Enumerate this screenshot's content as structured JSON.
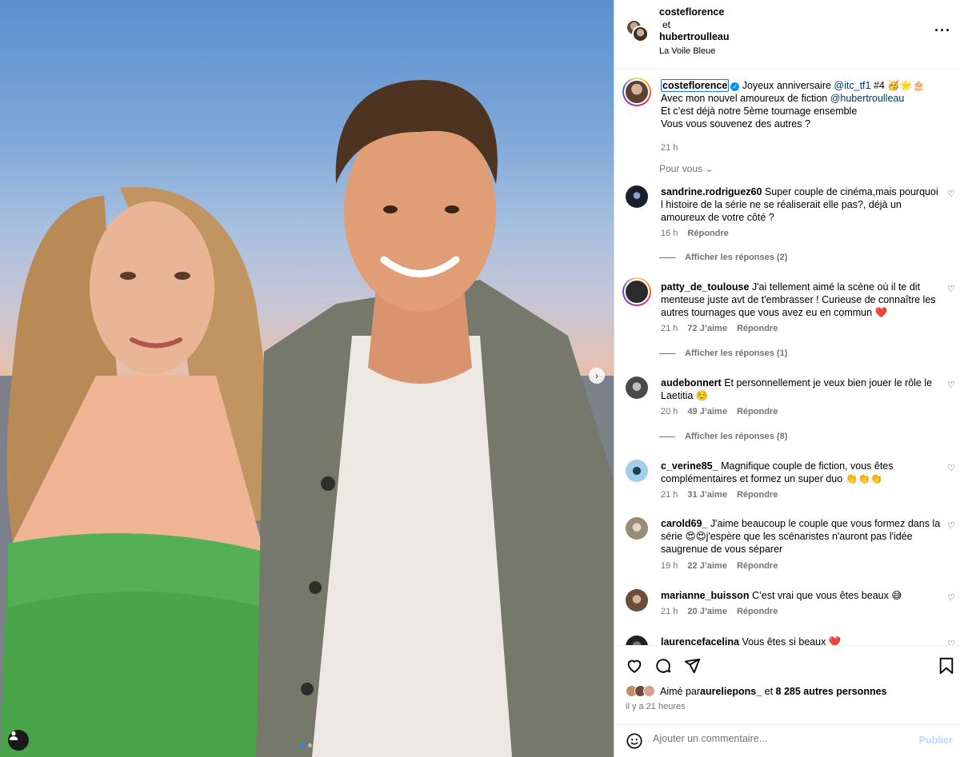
{
  "post": {
    "author": "costeflorence",
    "coauthor_sep": "et",
    "coauthor": "hubertroulleau",
    "location": "La Voile Bleue",
    "more_icon": "more-horizontal-icon"
  },
  "photo": {
    "next_icon": "chevron-right-icon",
    "tag_icon": "user-tag-icon",
    "carousel": {
      "count": 2,
      "active_index": 0
    }
  },
  "caption": {
    "username": "costeflorence",
    "verified": "✓",
    "line1_text": "Joyeux anniversaire ",
    "mention1": "@itc_tf1",
    "line1_tail": " #4 🥳🌟🎂",
    "line2_text": "Avec mon nouvel amoureux de fiction ",
    "mention2": "@hubertroulleau",
    "line3": "Et c’est déjà notre 5ème tournage ensemble",
    "line4": "Vous vous souvenez des autres ?",
    "time": "21 h"
  },
  "sort_label": "Pour vous",
  "comments": [
    {
      "username": "sandrine.rodriguez60",
      "text": "Super couple de cinéma,mais pourquoi l histoire de la série ne se réaliserait elle pas?, déjà un amoureux de votre côté ?",
      "time": "16 h",
      "likes": "",
      "reply": "Répondre",
      "replies": "Afficher les réponses (2)",
      "avatar": "#1b1e2c"
    },
    {
      "username": "patty_de_toulouse",
      "text": "J'ai tellement aimé la scène où il te dit menteuse juste avt de t'embrasser ! Curieuse de connaître les autres tournages que vous avez eu en commun ❤️",
      "time": "21 h",
      "likes": "72 J’aime",
      "reply": "Répondre",
      "replies": "Afficher les réponses (1)",
      "avatar": "#2b2b2b"
    },
    {
      "username": "audebonnert",
      "text": "Et personnellement je veux bien jouer le rôle le Laetitia ☺️",
      "time": "20 h",
      "likes": "49 J’aime",
      "reply": "Répondre",
      "replies": "Afficher les réponses (8)",
      "avatar": "#4a4a4a"
    },
    {
      "username": "c_verine85_",
      "text": "Magnifique couple de fiction, vous êtes complémentaires et formez un super duo 👏👏👏",
      "time": "21 h",
      "likes": "31 J’aime",
      "reply": "Répondre",
      "replies": "",
      "avatar": "#6aa7c8"
    },
    {
      "username": "carold69_",
      "text": "J'aime beaucoup le couple que vous formez dans la série 😍😍j'espère que les scénaristes n'auront pas l'idée saugrenue de vous séparer",
      "time": "19 h",
      "likes": "22 J’aime",
      "reply": "Répondre",
      "replies": "",
      "avatar": "#b7a898"
    },
    {
      "username": "marianne_buisson",
      "text": "C’est vrai que vous êtes beaux 😅",
      "time": "21 h",
      "likes": "20 J’aime",
      "reply": "Répondre",
      "replies": "",
      "avatar": "#8c6d5a"
    },
    {
      "username": "laurencefacelina",
      "text": "Vous êtes si beaux ❤️",
      "time": "",
      "likes": "",
      "reply": "",
      "replies": "",
      "avatar": "#3a3a3a"
    }
  ],
  "actions": {
    "like_icon": "heart-icon",
    "comment_icon": "comment-icon",
    "share_icon": "send-icon",
    "save_icon": "bookmark-icon",
    "liked_by_prefix": "Aimé par ",
    "liked_by_user": "aureliepons_",
    "liked_by_mid": " et ",
    "liked_by_count": "8 285 autres personnes",
    "post_time": "il y a 21 heures",
    "emoji_icon": "emoji-icon",
    "comment_placeholder": "Ajouter un commentaire...",
    "publish_label": "Publier"
  },
  "colors": {
    "link": "#00376b",
    "secondary_text": "#737373",
    "publish_disabled": "#b3dbff",
    "verified": "#0095f6"
  }
}
